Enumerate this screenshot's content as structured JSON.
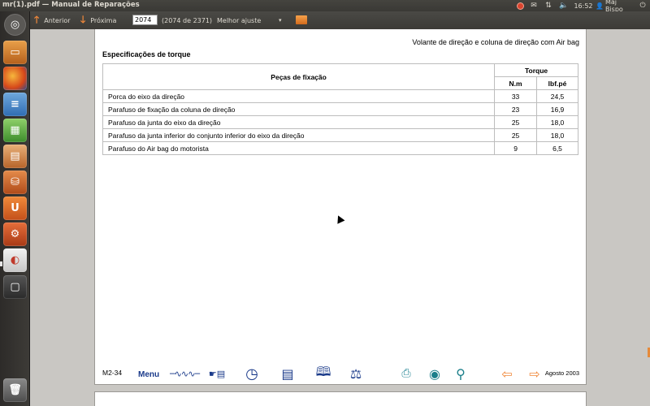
{
  "window": {
    "title": "mr(1).pdf — Manual de Reparações"
  },
  "panel": {
    "clock": "16:52",
    "user": "Maj Bispo"
  },
  "toolbar": {
    "prev_label": "Anterior",
    "next_label": "Próxima",
    "page_value": "2074",
    "page_count": "(2074 de 2371)",
    "zoom": "Melhor ajuste"
  },
  "document": {
    "header": "Volante de direção e coluna de direção com Air bag",
    "section_title": "Especificações de torque",
    "table": {
      "col_part": "Peças de fixação",
      "col_torque": "Torque",
      "col_nm": "N.m",
      "col_lbf": "lbf.pé",
      "rows": [
        {
          "part": "Porca do eixo da direção",
          "nm": "33",
          "lbf": "24,5"
        },
        {
          "part": "Parafuso de fixação da coluna de direção",
          "nm": "23",
          "lbf": "16,9"
        },
        {
          "part": "Parafuso da junta do eixo da direção",
          "nm": "25",
          "lbf": "18,0"
        },
        {
          "part": "Parafuso da junta inferior do conjunto inferior do eixo da direção",
          "nm": "25",
          "lbf": "18,0"
        },
        {
          "part": "Parafuso do Air bag do motorista",
          "nm": "9",
          "lbf": "6,5"
        }
      ]
    },
    "footer": {
      "page_code": "M2-34",
      "menu_label": "Menu",
      "date": "Agosto 2003"
    }
  },
  "icons": {
    "launcher": [
      "dash-home-icon",
      "files-icon",
      "firefox-icon",
      "writer-icon",
      "calc-icon",
      "impress-icon",
      "software-center-icon",
      "ubuntu-one-icon",
      "system-settings-icon",
      "document-viewer-icon",
      "workspace-icon",
      "trash-icon"
    ],
    "nav": [
      "circuit-icon",
      "pointer-hand-icon",
      "clock-icon",
      "pages-icon",
      "book-icon",
      "car-lift-icon",
      "print-icon",
      "eye-icon",
      "search-icon",
      "back-arrow-icon",
      "forward-arrow-icon"
    ]
  },
  "colors": {
    "accent_orange": "#f0883a",
    "nav_blue": "#1a3a8a",
    "nav_teal": "#1b7f8a",
    "panel_bg": "#3c3b37"
  }
}
